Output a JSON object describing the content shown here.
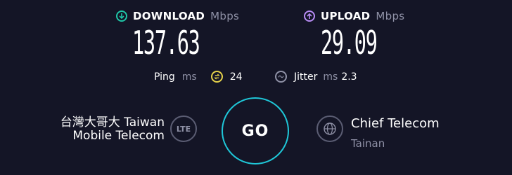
{
  "download": {
    "label": "DOWNLOAD",
    "unit": "Mbps",
    "value": "137.63",
    "icon": "arrow-down-circle-icon",
    "color": "#1fc7a8"
  },
  "upload": {
    "label": "UPLOAD",
    "unit": "Mbps",
    "value": "29.09",
    "icon": "arrow-up-circle-icon",
    "color": "#b88cf5"
  },
  "ping": {
    "label": "Ping",
    "unit": "ms",
    "value": "24",
    "icon_color": "#e6d24a"
  },
  "jitter": {
    "label": "Jitter",
    "unit": "ms",
    "value": "2.3"
  },
  "isp": {
    "name_line1": "台灣大哥大 Taiwan",
    "name_line2": "Mobile Telecom",
    "connection_type": "LTE"
  },
  "go_button": {
    "label": "GO",
    "color": "#1fc7d8"
  },
  "server": {
    "name": "Chief Telecom",
    "location": "Tainan"
  }
}
